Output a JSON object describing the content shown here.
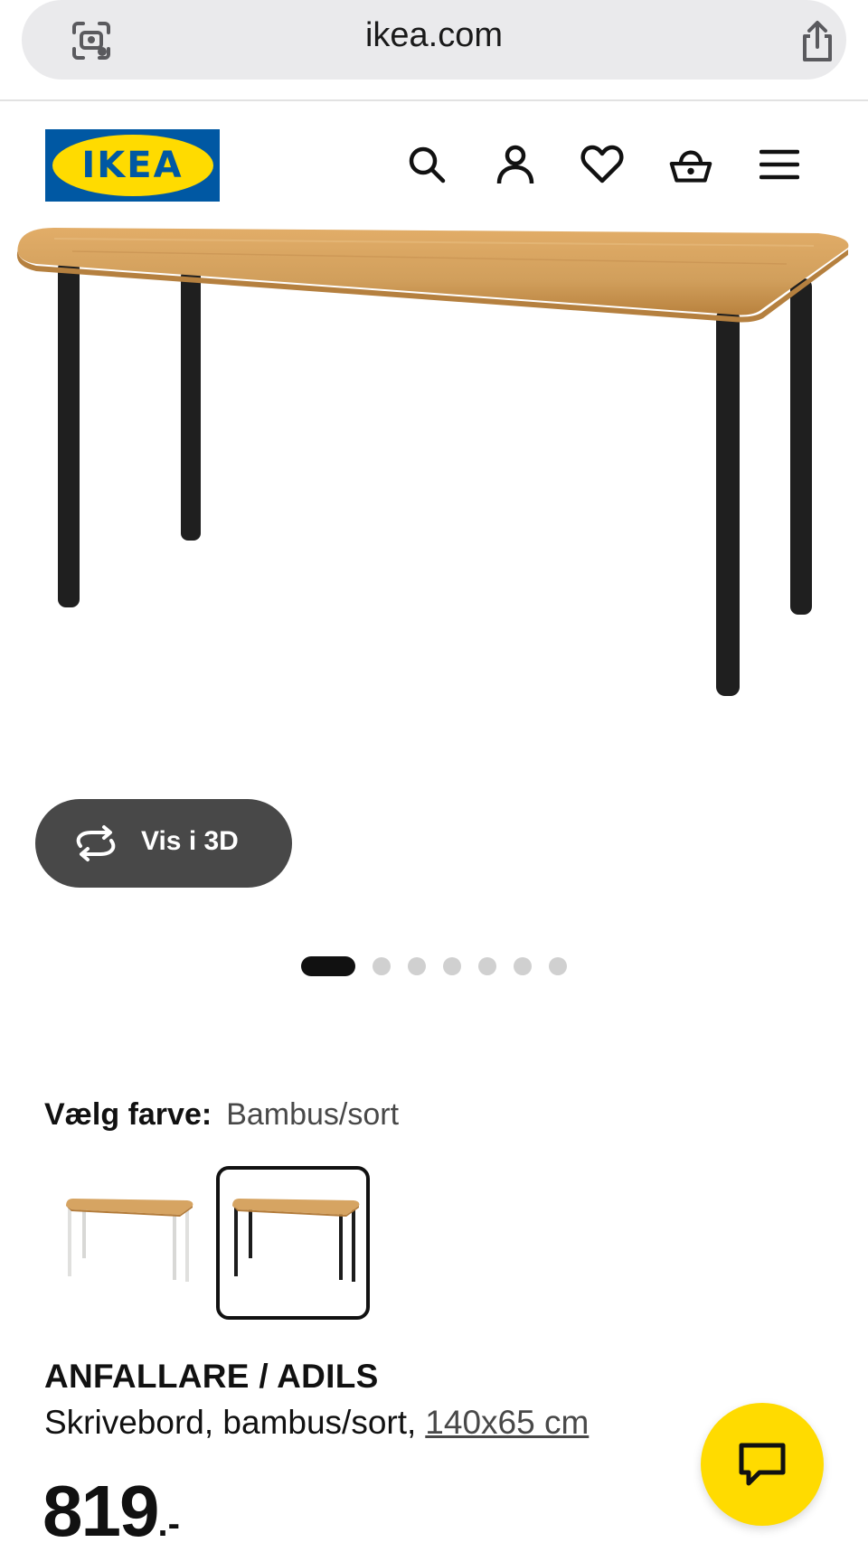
{
  "browser": {
    "url": "ikea.com"
  },
  "header": {
    "logo_text": "IKEA",
    "icons": [
      "search-icon",
      "account-icon",
      "heart-icon",
      "basket-icon",
      "menu-icon"
    ]
  },
  "product_media": {
    "view_3d_label": "Vis i 3D",
    "carousel": {
      "total": 7,
      "active_index": 0
    }
  },
  "color_selection": {
    "label": "Vælg farve:",
    "value": "Bambus/sort",
    "options": [
      {
        "name": "Bambus/hvid",
        "leg_color": "#e8e8e6",
        "selected": false
      },
      {
        "name": "Bambus/sort",
        "leg_color": "#1c1c1c",
        "selected": true
      }
    ]
  },
  "product": {
    "name": "ANFALLARE / ADILS",
    "description": "Skrivebord, bambus/sort,",
    "size": "140x65 cm",
    "price_main": "819",
    "price_suffix": ".-"
  },
  "colors": {
    "ikea_blue": "#0058a3",
    "ikea_yellow": "#ffdb00",
    "dark_button": "#484848"
  }
}
